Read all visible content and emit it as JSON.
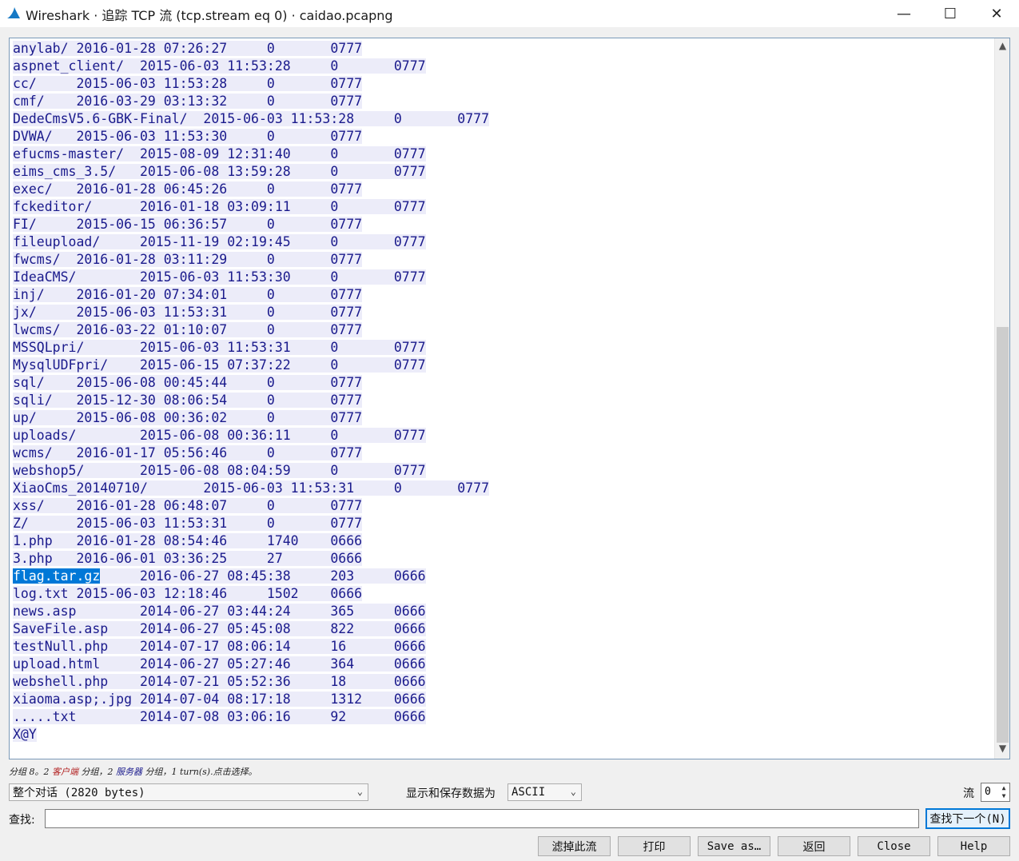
{
  "window": {
    "title": "Wireshark · 追踪 TCP 流 (tcp.stream eq 0) · caidao.pcapng",
    "minimize": "—",
    "maximize": "☐",
    "close": "✕"
  },
  "stream": {
    "lines": [
      [
        "anylab/ 2016-01-28 07:26:27     0       0777"
      ],
      [
        "aspnet_client/  2015-06-03 11:53:28     0       0777"
      ],
      [
        "cc/     2015-06-03 11:53:28     0       0777"
      ],
      [
        "cmf/    2016-03-29 03:13:32     0       0777"
      ],
      [
        "DedeCmsV5.6-GBK-Final/  2015-06-03 11:53:28     0       0777"
      ],
      [
        "DVWA/   2015-06-03 11:53:30     0       0777"
      ],
      [
        "efucms-master/  2015-08-09 12:31:40     0       0777"
      ],
      [
        "eims_cms_3.5/   2015-06-08 13:59:28     0       0777"
      ],
      [
        "exec/   2016-01-28 06:45:26     0       0777"
      ],
      [
        "fckeditor/      2016-01-18 03:09:11     0       0777"
      ],
      [
        "FI/     2015-06-15 06:36:57     0       0777"
      ],
      [
        "fileupload/     2015-11-19 02:19:45     0       0777"
      ],
      [
        "fwcms/  2016-01-28 03:11:29     0       0777"
      ],
      [
        "IdeaCMS/        2015-06-03 11:53:30     0       0777"
      ],
      [
        "inj/    2016-01-20 07:34:01     0       0777"
      ],
      [
        "jx/     2015-06-03 11:53:31     0       0777"
      ],
      [
        "lwcms/  2016-03-22 01:10:07     0       0777"
      ],
      [
        "MSSQLpri/       2015-06-03 11:53:31     0       0777"
      ],
      [
        "MysqlUDFpri/    2015-06-15 07:37:22     0       0777"
      ],
      [
        "sql/    2015-06-08 00:45:44     0       0777"
      ],
      [
        "sqli/   2015-12-30 08:06:54     0       0777"
      ],
      [
        "up/     2015-06-08 00:36:02     0       0777"
      ],
      [
        "uploads/        2015-06-08 00:36:11     0       0777"
      ],
      [
        "wcms/   2016-01-17 05:56:46     0       0777"
      ],
      [
        "webshop5/       2015-06-08 08:04:59     0       0777"
      ],
      [
        "XiaoCms_20140710/       2015-06-03 11:53:31     0       0777"
      ],
      [
        "xss/    2016-01-28 06:48:07     0       0777"
      ],
      [
        "Z/      2015-06-03 11:53:31     0       0777"
      ],
      [
        "1.php   2016-01-28 08:54:46     1740    0666"
      ],
      [
        "3.php   2016-06-01 03:36:25     27      0666"
      ],
      [
        "flag.tar.gz",
        "     2016-06-27 08:45:38     203     0666"
      ],
      [
        "log.txt 2015-06-03 12:18:46     1502    0666"
      ],
      [
        "news.asp        2014-06-27 03:44:24     365     0666"
      ],
      [
        "SaveFile.asp    2014-06-27 05:45:08     822     0666"
      ],
      [
        "testNull.php    2014-07-17 08:06:14     16      0666"
      ],
      [
        "upload.html     2014-06-27 05:27:46     364     0666"
      ],
      [
        "webshell.php    2014-07-21 05:52:36     18      0666"
      ],
      [
        "xiaoma.asp;.jpg 2014-07-04 08:17:18     1312    0666"
      ],
      [
        ".....txt        2014-07-08 03:06:16     92      0666"
      ],
      [
        "X@Y"
      ]
    ]
  },
  "status": {
    "prefix": "分组 8。2 ",
    "client": "客户端",
    "middle": " 分组，2 ",
    "server": "服务器",
    "suffix": " 分组，1 turn(s).点击选择。"
  },
  "controls": {
    "conversation": "整个对话 (2820 bytes)",
    "format_label": "显示和保存数据为",
    "format_value": "ASCII",
    "stream_label": "流",
    "stream_value": "0",
    "find_label": "查找:",
    "find_value": "",
    "find_next": "查找下一个(N)"
  },
  "buttons": {
    "filter_out": "滤掉此流",
    "print": "打印",
    "save_as": "Save as…",
    "back": "返回",
    "close": "Close",
    "help": "Help"
  },
  "colors": {
    "client_text": "#1a1a8c",
    "client_bg": "#ececf9",
    "selection": "#0078d7"
  }
}
